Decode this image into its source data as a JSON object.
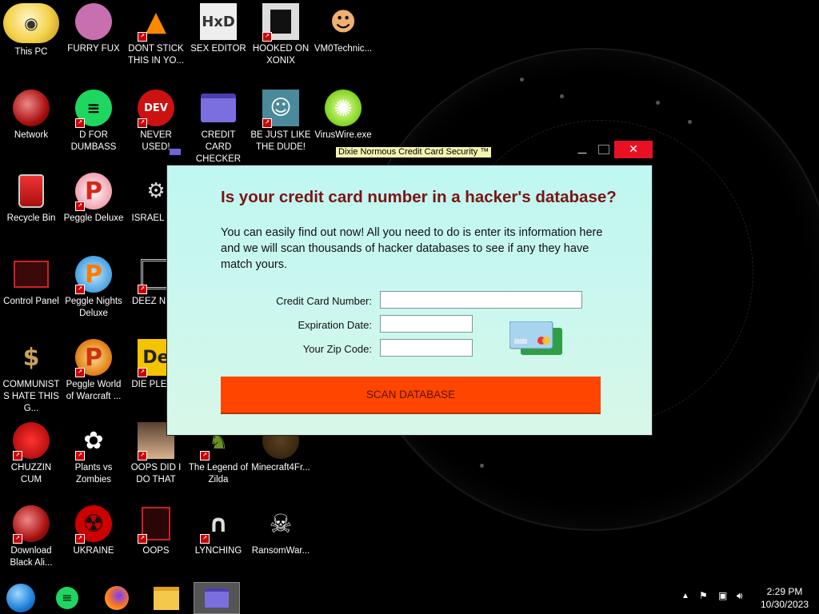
{
  "desktop": {
    "icons": [
      {
        "label": "This PC"
      },
      {
        "label": "FURRY FUX"
      },
      {
        "label": "DONT STICK THIS IN YO..."
      },
      {
        "label": "SEX EDITOR"
      },
      {
        "label": "HOOKED ON XONIX"
      },
      {
        "label": "VM0Technic..."
      },
      {
        "label": "Network"
      },
      {
        "label": "D FOR DUMBASS"
      },
      {
        "label": "NEVER USED!"
      },
      {
        "label": "CREDIT CARD CHECKER"
      },
      {
        "label": "BE JUST LIKE THE DUDE!"
      },
      {
        "label": "VirusWire.exe"
      },
      {
        "label": "Recycle Bin"
      },
      {
        "label": "Peggle Deluxe"
      },
      {
        "label": "ISRAEL S..."
      },
      {
        "label": "Control Panel"
      },
      {
        "label": "Peggle Nights Deluxe"
      },
      {
        "label": "DEEZ NU..."
      },
      {
        "label": "COMMUNISTS HATE THIS G..."
      },
      {
        "label": "Peggle World of Warcraft ..."
      },
      {
        "label": "DIE PLEA..."
      },
      {
        "label": "CHUZZIN CUM"
      },
      {
        "label": "Plants vs Zombies"
      },
      {
        "label": "OOPS DID I DO THAT"
      },
      {
        "label": "The Legend of Zilda"
      },
      {
        "label": "Minecraft4Fr..."
      },
      {
        "label": "Download Black Ali..."
      },
      {
        "label": "UKRAINE"
      },
      {
        "label": "OOPS"
      },
      {
        "label": "LYNCHING"
      },
      {
        "label": "RansomWar..."
      }
    ]
  },
  "dialog": {
    "window_title": "Dixie Normous Credit Card Security ™",
    "close_glyph": "✕",
    "heading": "Is your credit card number in a hacker's database?",
    "body": "You can easily find out now! All you need to do is enter its information here and we will scan thousands of hacker databases to see if any they have match yours.",
    "fields": {
      "card_number_label": "Credit Card Number:",
      "card_number_value": "",
      "expiration_label": "Expiration Date:",
      "expiration_value": "",
      "zip_label": "Your Zip Code:",
      "zip_value": ""
    },
    "scan_button": "SCAN DATABASE",
    "accent_color": "#ff4500",
    "heading_color": "#7b1414"
  },
  "taskbar": {
    "time": "2:29 PM",
    "date": "10/30/2023",
    "items": [
      "start-orb-icon",
      "d-for-dumbass-icon",
      "firefox-icon",
      "file-explorer-icon",
      "credit-card-checker-icon"
    ]
  }
}
